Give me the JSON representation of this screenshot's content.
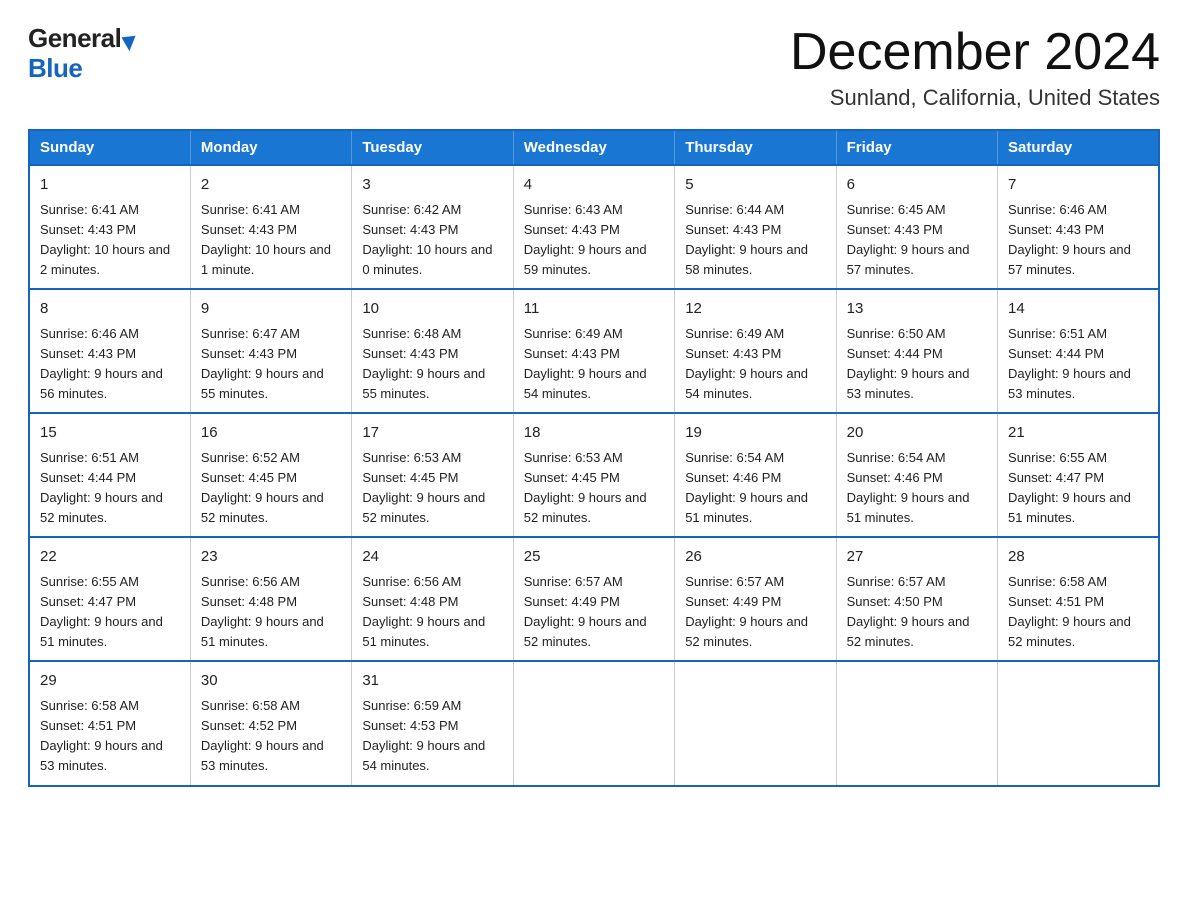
{
  "header": {
    "logo_line1": "General",
    "logo_line2": "Blue",
    "title": "December 2024",
    "subtitle": "Sunland, California, United States"
  },
  "calendar": {
    "weekdays": [
      "Sunday",
      "Monday",
      "Tuesday",
      "Wednesday",
      "Thursday",
      "Friday",
      "Saturday"
    ],
    "weeks": [
      [
        {
          "day": "1",
          "sunrise": "6:41 AM",
          "sunset": "4:43 PM",
          "daylight": "10 hours and 2 minutes."
        },
        {
          "day": "2",
          "sunrise": "6:41 AM",
          "sunset": "4:43 PM",
          "daylight": "10 hours and 1 minute."
        },
        {
          "day": "3",
          "sunrise": "6:42 AM",
          "sunset": "4:43 PM",
          "daylight": "10 hours and 0 minutes."
        },
        {
          "day": "4",
          "sunrise": "6:43 AM",
          "sunset": "4:43 PM",
          "daylight": "9 hours and 59 minutes."
        },
        {
          "day": "5",
          "sunrise": "6:44 AM",
          "sunset": "4:43 PM",
          "daylight": "9 hours and 58 minutes."
        },
        {
          "day": "6",
          "sunrise": "6:45 AM",
          "sunset": "4:43 PM",
          "daylight": "9 hours and 57 minutes."
        },
        {
          "day": "7",
          "sunrise": "6:46 AM",
          "sunset": "4:43 PM",
          "daylight": "9 hours and 57 minutes."
        }
      ],
      [
        {
          "day": "8",
          "sunrise": "6:46 AM",
          "sunset": "4:43 PM",
          "daylight": "9 hours and 56 minutes."
        },
        {
          "day": "9",
          "sunrise": "6:47 AM",
          "sunset": "4:43 PM",
          "daylight": "9 hours and 55 minutes."
        },
        {
          "day": "10",
          "sunrise": "6:48 AM",
          "sunset": "4:43 PM",
          "daylight": "9 hours and 55 minutes."
        },
        {
          "day": "11",
          "sunrise": "6:49 AM",
          "sunset": "4:43 PM",
          "daylight": "9 hours and 54 minutes."
        },
        {
          "day": "12",
          "sunrise": "6:49 AM",
          "sunset": "4:43 PM",
          "daylight": "9 hours and 54 minutes."
        },
        {
          "day": "13",
          "sunrise": "6:50 AM",
          "sunset": "4:44 PM",
          "daylight": "9 hours and 53 minutes."
        },
        {
          "day": "14",
          "sunrise": "6:51 AM",
          "sunset": "4:44 PM",
          "daylight": "9 hours and 53 minutes."
        }
      ],
      [
        {
          "day": "15",
          "sunrise": "6:51 AM",
          "sunset": "4:44 PM",
          "daylight": "9 hours and 52 minutes."
        },
        {
          "day": "16",
          "sunrise": "6:52 AM",
          "sunset": "4:45 PM",
          "daylight": "9 hours and 52 minutes."
        },
        {
          "day": "17",
          "sunrise": "6:53 AM",
          "sunset": "4:45 PM",
          "daylight": "9 hours and 52 minutes."
        },
        {
          "day": "18",
          "sunrise": "6:53 AM",
          "sunset": "4:45 PM",
          "daylight": "9 hours and 52 minutes."
        },
        {
          "day": "19",
          "sunrise": "6:54 AM",
          "sunset": "4:46 PM",
          "daylight": "9 hours and 51 minutes."
        },
        {
          "day": "20",
          "sunrise": "6:54 AM",
          "sunset": "4:46 PM",
          "daylight": "9 hours and 51 minutes."
        },
        {
          "day": "21",
          "sunrise": "6:55 AM",
          "sunset": "4:47 PM",
          "daylight": "9 hours and 51 minutes."
        }
      ],
      [
        {
          "day": "22",
          "sunrise": "6:55 AM",
          "sunset": "4:47 PM",
          "daylight": "9 hours and 51 minutes."
        },
        {
          "day": "23",
          "sunrise": "6:56 AM",
          "sunset": "4:48 PM",
          "daylight": "9 hours and 51 minutes."
        },
        {
          "day": "24",
          "sunrise": "6:56 AM",
          "sunset": "4:48 PM",
          "daylight": "9 hours and 51 minutes."
        },
        {
          "day": "25",
          "sunrise": "6:57 AM",
          "sunset": "4:49 PM",
          "daylight": "9 hours and 52 minutes."
        },
        {
          "day": "26",
          "sunrise": "6:57 AM",
          "sunset": "4:49 PM",
          "daylight": "9 hours and 52 minutes."
        },
        {
          "day": "27",
          "sunrise": "6:57 AM",
          "sunset": "4:50 PM",
          "daylight": "9 hours and 52 minutes."
        },
        {
          "day": "28",
          "sunrise": "6:58 AM",
          "sunset": "4:51 PM",
          "daylight": "9 hours and 52 minutes."
        }
      ],
      [
        {
          "day": "29",
          "sunrise": "6:58 AM",
          "sunset": "4:51 PM",
          "daylight": "9 hours and 53 minutes."
        },
        {
          "day": "30",
          "sunrise": "6:58 AM",
          "sunset": "4:52 PM",
          "daylight": "9 hours and 53 minutes."
        },
        {
          "day": "31",
          "sunrise": "6:59 AM",
          "sunset": "4:53 PM",
          "daylight": "9 hours and 54 minutes."
        },
        null,
        null,
        null,
        null
      ]
    ]
  }
}
